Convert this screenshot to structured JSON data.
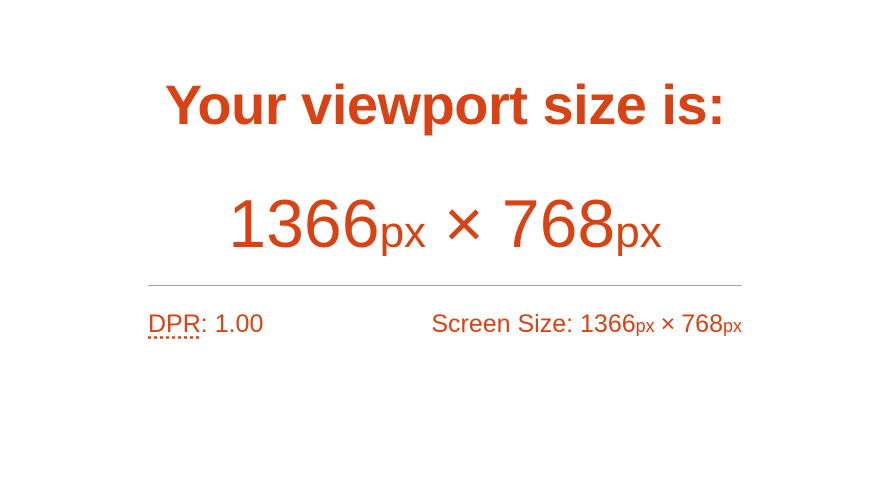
{
  "heading": "Your viewport size is:",
  "viewport": {
    "width": "1366",
    "height": "768",
    "unit": "px",
    "times": "×"
  },
  "dpr": {
    "label": "DPR",
    "separator": ":",
    "value": "1.00"
  },
  "screen": {
    "label": "Screen Size:",
    "width": "1366",
    "height": "768",
    "unit": "px",
    "times": "×"
  },
  "colors": {
    "accent": "#d84315",
    "divider": "#a6a6a6",
    "background": "#ffffff"
  }
}
